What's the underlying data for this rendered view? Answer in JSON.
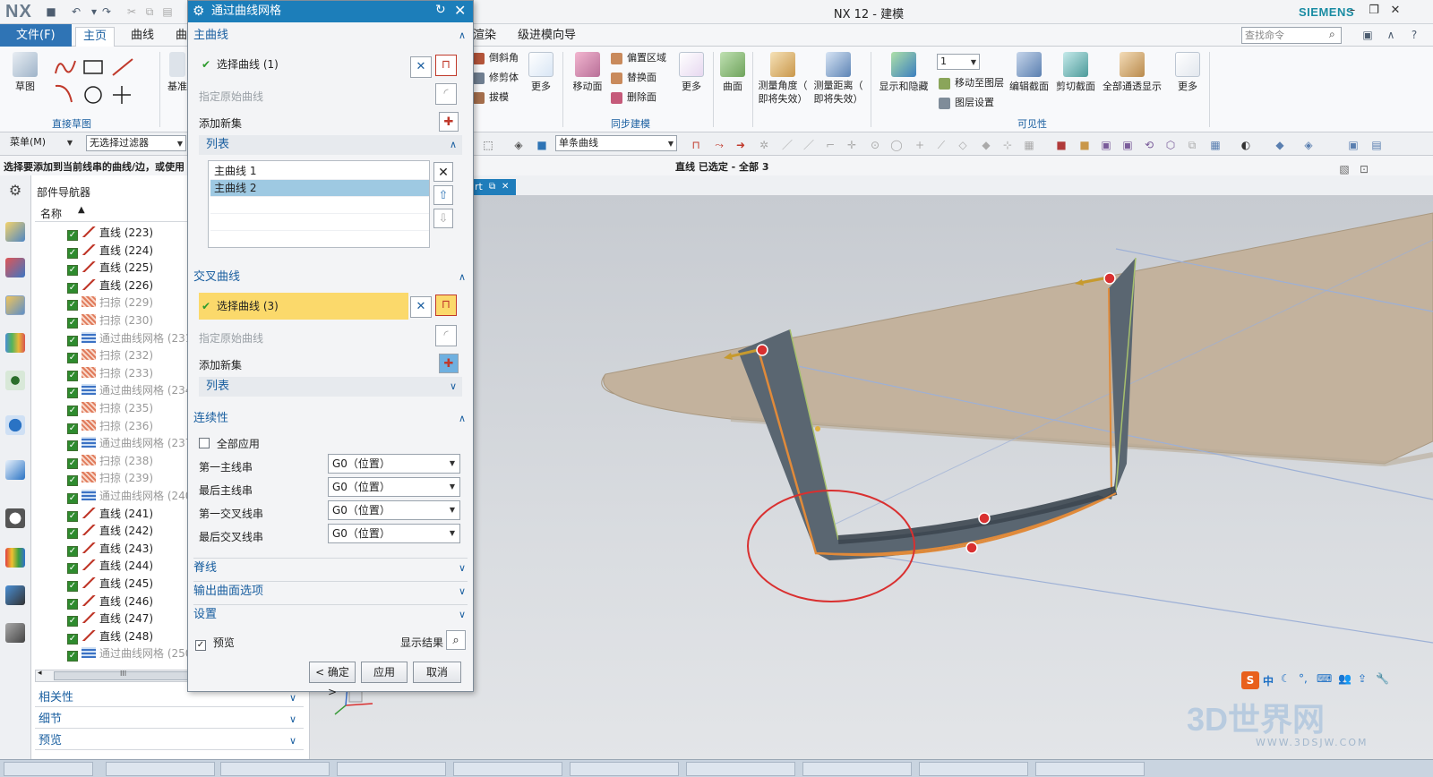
{
  "app": {
    "logo": "NX",
    "title": "NX 12 - 建模",
    "brand": "SIEMENS"
  },
  "ribbon_tabs": [
    "文件(F)",
    "主页",
    "曲线",
    "曲",
    "渲染",
    "级进模向导"
  ],
  "command_search": {
    "placeholder": "查找命令"
  },
  "ribbon": {
    "left_buttons": {
      "sketch": "草图",
      "datum": "基准"
    },
    "direct_sketch_label": "直接草图",
    "feature_small": [
      "倒斜角",
      "修剪体",
      "拔模"
    ],
    "more": "更多",
    "move_face": "移动面",
    "sync_small": [
      "偏置区域",
      "替换面",
      "删除面"
    ],
    "sync_label": "同步建模",
    "surface": "曲面",
    "measure_angle": [
      "测量角度（",
      "即将失效）"
    ],
    "measure_distance": [
      "测量距离（",
      "即将失效）"
    ],
    "show_hide": "显示和隐藏",
    "layer_value": "1",
    "layer_small": [
      "移动至图层",
      "图层设置"
    ],
    "edit_section": "编辑截面",
    "clip_section": "剪切截面",
    "see_through": "全部通透显示",
    "visibility_label": "可见性"
  },
  "selection_bar": {
    "menu": "菜单(M)",
    "filter": "无选择过滤器",
    "curve_rule": "单条曲线"
  },
  "prompt": "选择要添加到当前线串的曲线/边，或使用",
  "status_message": "直线 已选定 - 全部 3",
  "part_navigator": {
    "title": "部件导航器",
    "column": "名称",
    "rows": [
      {
        "label": "直线 (223)",
        "type": "line",
        "dim": false
      },
      {
        "label": "直线 (224)",
        "type": "line",
        "dim": false
      },
      {
        "label": "直线 (225)",
        "type": "line",
        "dim": false
      },
      {
        "label": "直线 (226)",
        "type": "line",
        "dim": false
      },
      {
        "label": "扫掠 (229)",
        "type": "sweep",
        "dim": true
      },
      {
        "label": "扫掠 (230)",
        "type": "sweep",
        "dim": true
      },
      {
        "label": "通过曲线网格 (231",
        "type": "mesh",
        "dim": true
      },
      {
        "label": "扫掠 (232)",
        "type": "sweep",
        "dim": true
      },
      {
        "label": "扫掠 (233)",
        "type": "sweep",
        "dim": true
      },
      {
        "label": "通过曲线网格 (234",
        "type": "mesh",
        "dim": true
      },
      {
        "label": "扫掠 (235)",
        "type": "sweep",
        "dim": true
      },
      {
        "label": "扫掠 (236)",
        "type": "sweep",
        "dim": true
      },
      {
        "label": "通过曲线网格 (237",
        "type": "mesh",
        "dim": true
      },
      {
        "label": "扫掠 (238)",
        "type": "sweep",
        "dim": true
      },
      {
        "label": "扫掠 (239)",
        "type": "sweep",
        "dim": true
      },
      {
        "label": "通过曲线网格 (240",
        "type": "mesh",
        "dim": true
      },
      {
        "label": "直线 (241)",
        "type": "line",
        "dim": false
      },
      {
        "label": "直线 (242)",
        "type": "line",
        "dim": false
      },
      {
        "label": "直线 (243)",
        "type": "line",
        "dim": false
      },
      {
        "label": "直线 (244)",
        "type": "line",
        "dim": false
      },
      {
        "label": "直线 (245)",
        "type": "line",
        "dim": false
      },
      {
        "label": "直线 (246)",
        "type": "line",
        "dim": false
      },
      {
        "label": "直线 (247)",
        "type": "line",
        "dim": false
      },
      {
        "label": "直线 (248)",
        "type": "line",
        "dim": false
      },
      {
        "label": "通过曲线网格 (250",
        "type": "mesh",
        "dim": true
      }
    ],
    "scroll_label": "III",
    "sections": [
      "相关性",
      "细节",
      "预览"
    ]
  },
  "viewport_tab": "rt",
  "dialog": {
    "title": "通过曲线网格",
    "primary_section": "主曲线",
    "primary_select": "选择曲线 (1)",
    "origin_curve": "指定原始曲线",
    "add_new_set": "添加新集",
    "list_header": "列表",
    "list_items": [
      "主曲线 1",
      "主曲线 2"
    ],
    "cross_section": "交叉曲线",
    "cross_select": "选择曲线 (3)",
    "cross_origin": "指定原始曲线",
    "cross_add": "添加新集",
    "cross_list": "列表",
    "continuity_section": "连续性",
    "apply_all": "全部应用",
    "continuity_rows": [
      {
        "label": "第一主线串",
        "value": "G0（位置）"
      },
      {
        "label": "最后主线串",
        "value": "G0（位置）"
      },
      {
        "label": "第一交叉线串",
        "value": "G0（位置）"
      },
      {
        "label": "最后交叉线串",
        "value": "G0（位置）"
      }
    ],
    "spine": "脊线",
    "output_options": "输出曲面选项",
    "settings": "设置",
    "preview": "预览",
    "show_result": "显示结果",
    "ok": "< 确定 >",
    "apply": "应用",
    "cancel": "取消"
  },
  "ime": {
    "label": "中"
  },
  "watermark": {
    "text": "3D世界网",
    "url": "WWW.3DSJW.COM"
  },
  "colors": {
    "accent": "#1c7eba",
    "selection_yellow": "#fbd96b",
    "surface_dark": "#3c4650",
    "edge_orange": "#f0a040",
    "annotation_red": "#d93030"
  }
}
